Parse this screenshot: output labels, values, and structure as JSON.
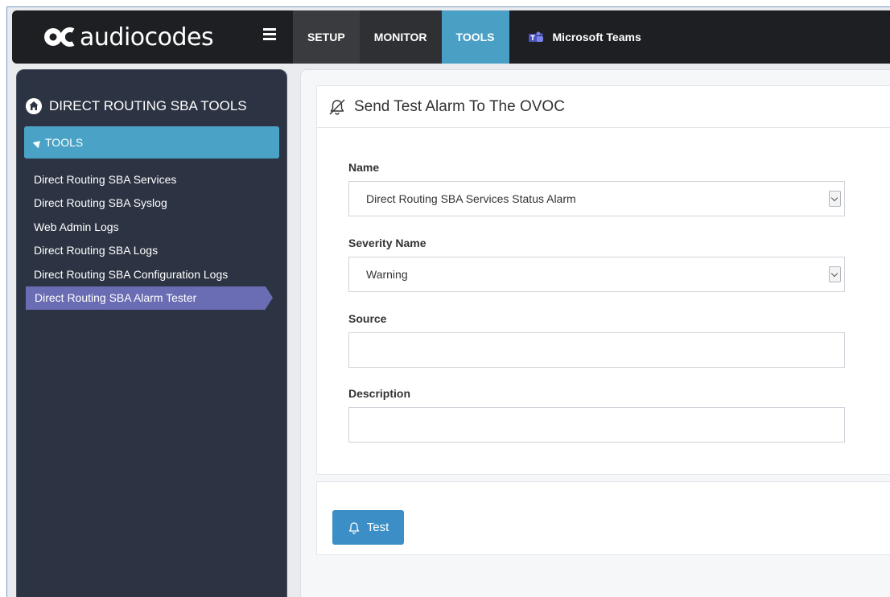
{
  "header": {
    "logo_text": "audiocodes",
    "nav": [
      {
        "label": "SETUP"
      },
      {
        "label": "MONITOR"
      },
      {
        "label": "TOOLS"
      }
    ],
    "teams_label": "Microsoft Teams"
  },
  "sidebar": {
    "title": "DIRECT ROUTING SBA TOOLS",
    "section_label": "TOOLS",
    "items": [
      {
        "label": "Direct Routing SBA Services"
      },
      {
        "label": "Direct Routing SBA Syslog"
      },
      {
        "label": "Web Admin Logs"
      },
      {
        "label": "Direct Routing SBA Logs"
      },
      {
        "label": "Direct Routing SBA Configuration Logs"
      },
      {
        "label": "Direct Routing SBA Alarm Tester"
      }
    ],
    "active_item": "Direct Routing SBA Alarm Tester"
  },
  "main": {
    "title": "Send Test Alarm To The OVOC",
    "name_label": "Name",
    "name_value": "Direct Routing SBA Services Status Alarm",
    "severity_label": "Severity Name",
    "severity_value": "Warning",
    "source_label": "Source",
    "source_value": "",
    "description_label": "Description",
    "description_value": "",
    "test_button": "Test"
  },
  "colors": {
    "topbar": "#1d1f23",
    "tools_active": "#4a9fc5",
    "sidebar_bg": "#2c3443",
    "sidebar_active": "#6a6cb4",
    "button": "#3b8fc6"
  }
}
